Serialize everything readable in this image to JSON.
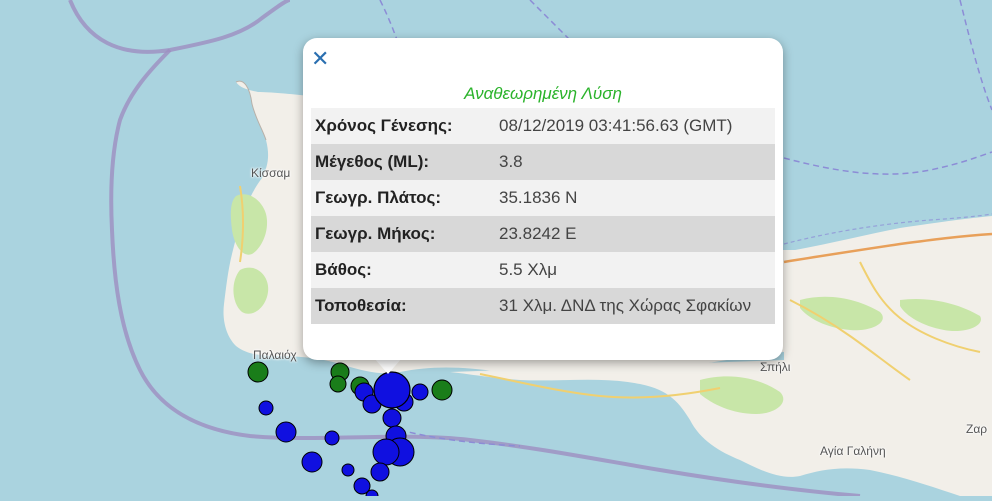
{
  "map": {
    "places": {
      "kissamos": "Κίσσαμ",
      "palaiochora": "Παλαιόχ",
      "spili": "Σπήλι",
      "agia_galini": "Αγία Γαλήνη",
      "zaros": "Ζαρ"
    },
    "colors": {
      "sea": "#aad3df",
      "land": "#f2efe9",
      "green_area": "#c8e6a8",
      "boundary": "#9e8fc0",
      "quake_blue": "#1010e0",
      "quake_green": "#1a7d1a"
    }
  },
  "popup": {
    "close_icon": "close-icon",
    "title": "Αναθεωρημένη Λύση",
    "rows": [
      {
        "label": "Χρόνος Γένεσης:",
        "value": "08/12/2019 03:41:56.63 (GMT)"
      },
      {
        "label": "Μέγεθος (ML):",
        "value": "3.8"
      },
      {
        "label": "Γεωγρ. Πλάτος:",
        "value": "35.1836 N"
      },
      {
        "label": "Γεωγρ. Μήκος:",
        "value": "23.8242 E"
      },
      {
        "label": "Βάθος:",
        "value": "5.5 Χλμ"
      },
      {
        "label": "Τοποθεσία:",
        "value": "31 Χλμ. ΔΝΔ της Χώρας Σφακίων"
      }
    ]
  }
}
